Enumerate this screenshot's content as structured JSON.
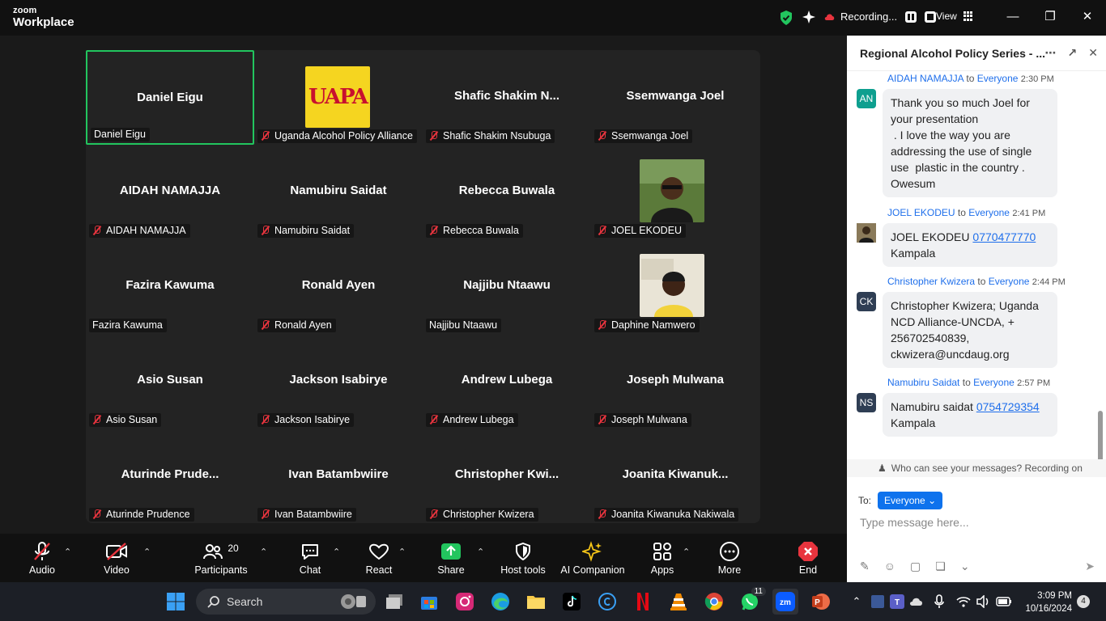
{
  "app": {
    "brand_line1": "zoom",
    "brand_line2": "Workplace"
  },
  "topbar": {
    "recording": "Recording...",
    "view": "View"
  },
  "tiles": [
    {
      "big": "Daniel Eigu",
      "label": "Daniel Eigu",
      "muted": false,
      "active": true
    },
    {
      "big": "",
      "label": "Uganda Alcohol Policy Alliance",
      "muted": true,
      "logo": "UAPA"
    },
    {
      "big": "Shafic  Shakim  N...",
      "label": "Shafic Shakim Nsubuga",
      "muted": true
    },
    {
      "big": "Ssemwanga Joel",
      "label": "Ssemwanga Joel",
      "muted": true
    },
    {
      "big": "AIDAH NAMAJJA",
      "label": "AIDAH NAMAJJA",
      "muted": true
    },
    {
      "big": "Namubiru Saidat",
      "label": "Namubiru Saidat",
      "muted": true
    },
    {
      "big": "Rebecca Buwala",
      "label": "Rebecca Buwala",
      "muted": true
    },
    {
      "big": "",
      "label": "JOEL EKODEU",
      "muted": true,
      "photo": true
    },
    {
      "big": "Fazira Kawuma",
      "label": "Fazira Kawuma",
      "muted": false
    },
    {
      "big": "Ronald Ayen",
      "label": "Ronald Ayen",
      "muted": true
    },
    {
      "big": "Najjibu Ntaawu",
      "label": "Najjibu Ntaawu",
      "muted": false
    },
    {
      "big": "",
      "label": "Daphine Namwero",
      "muted": true,
      "photo": true
    },
    {
      "big": "Asio Susan",
      "label": "Asio Susan",
      "muted": true
    },
    {
      "big": "Jackson Isabirye",
      "label": "Jackson Isabirye",
      "muted": true
    },
    {
      "big": "Andrew Lubega",
      "label": "Andrew Lubega",
      "muted": true
    },
    {
      "big": "Joseph Mulwana",
      "label": "Joseph Mulwana",
      "muted": true
    },
    {
      "big": "Aturinde  Prude...",
      "label": "Aturinde Prudence",
      "muted": true
    },
    {
      "big": "Ivan Batambwiire",
      "label": "Ivan Batambwiire",
      "muted": true
    },
    {
      "big": "Christopher  Kwi...",
      "label": "Christopher Kwizera",
      "muted": true
    },
    {
      "big": "Joanita  Kiwanuk...",
      "label": "Joanita Kiwanuka Nakiwala",
      "muted": true
    }
  ],
  "toolbar": {
    "audio": "Audio",
    "video": "Video",
    "participants": "Participants",
    "participant_count": "20",
    "chat": "Chat",
    "react": "React",
    "share": "Share",
    "host_tools": "Host tools",
    "ai_companion": "AI Companion",
    "apps": "Apps",
    "more": "More",
    "end": "End"
  },
  "chat": {
    "title": "Regional Alcohol Policy Series - ...",
    "messages": [
      {
        "initials": "AN",
        "sender": "AIDAH NAMAJJA",
        "to": "to",
        "recipient": "Everyone",
        "time": "2:30 PM",
        "lines": [
          "Thank you so much Joel for",
          "your presentation",
          " . I love the way you are",
          "addressing the use of single",
          "use  plastic in the country .",
          "Owesum"
        ]
      },
      {
        "initials": "",
        "sender": "JOEL EKODEU",
        "to": "to",
        "recipient": "Everyone",
        "time": "2:41 PM",
        "text_prefix": "JOEL EKODEU ",
        "link": "0770477770",
        "text_suffix": "Kampala"
      },
      {
        "initials": "CK",
        "sender": "Christopher Kwizera",
        "to": "to",
        "recipient": "Everyone",
        "time": "2:44 PM",
        "lines": [
          "Christopher Kwizera; Uganda",
          "NCD Alliance-UNCDA, +",
          "256702540839,",
          "ckwizera@uncdaug.org"
        ]
      },
      {
        "initials": "NS",
        "sender": "Namubiru Saidat",
        "to": "to",
        "recipient": "Everyone",
        "time": "2:57 PM",
        "text_prefix": "Namubiru saidat ",
        "link": "0754729354",
        "text_suffix": "Kampala"
      }
    ],
    "who_can_see": "Who can see your messages? Recording on",
    "to_label": "To:",
    "to_value": "Everyone",
    "placeholder": "Type message here..."
  },
  "taskbar": {
    "search": "Search",
    "whatsapp_badge": "11",
    "time": "3:09 PM",
    "date": "10/16/2024",
    "notifications": "4"
  }
}
